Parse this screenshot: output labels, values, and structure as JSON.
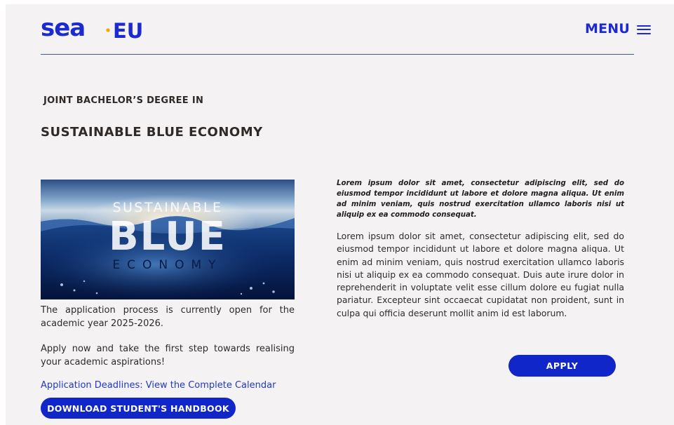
{
  "header": {
    "logo": {
      "text_main": "sea",
      "separator": "·",
      "text_suffix": "EU",
      "color": "#1b2ad1",
      "dot_color": "#f2a900"
    },
    "menu_label": "MENU",
    "menu_icon": "hamburger-icon"
  },
  "program": {
    "eyebrow": "JOINT BACHELOR’S DEGREE IN",
    "title": "SUSTAINABLE BLUE ECONOMY"
  },
  "hero": {
    "line1": "SUSTAINABLE",
    "line2": "BLUE",
    "line3": "ECONOMY"
  },
  "left": {
    "paragraph1": "The application process is currently open for the academic year 2025-2026.",
    "paragraph2": "Apply now and take the first step towards realising your academic aspirations!",
    "deadline_link": "Application Deadlines: View the Complete Calendar",
    "handbook_button": "DOWNLOAD STUDENT'S HANDBOOK"
  },
  "right": {
    "intro_bold": "Lorem ipsum dolor sit amet, consectetur adipiscing elit, sed do eiusmod tempor incididunt ut labore et dolore magna aliqua. Ut enim ad minim veniam, quis nostrud exercitation ullamco laboris nisi ut aliquip ex ea commodo consequat.",
    "body": "Lorem ipsum dolor sit amet, consectetur adipiscing elit, sed do eiusmod tempor incididunt ut labore et dolore magna aliqua. Ut enim ad minim veniam, quis nostrud exercitation ullamco laboris nisi ut aliquip ex ea commodo consequat. Duis aute irure dolor in reprehenderit in voluptate velit esse cillum dolore eu fugiat nulla pariatur. Excepteur sint occaecat cupidatat non proident, sunt in culpa qui officia deserunt mollit anim id est laborum.",
    "apply_button": "APPLY"
  },
  "colors": {
    "accent": "#1126c8",
    "link": "#2138c9",
    "background": "#f4f2f2"
  }
}
